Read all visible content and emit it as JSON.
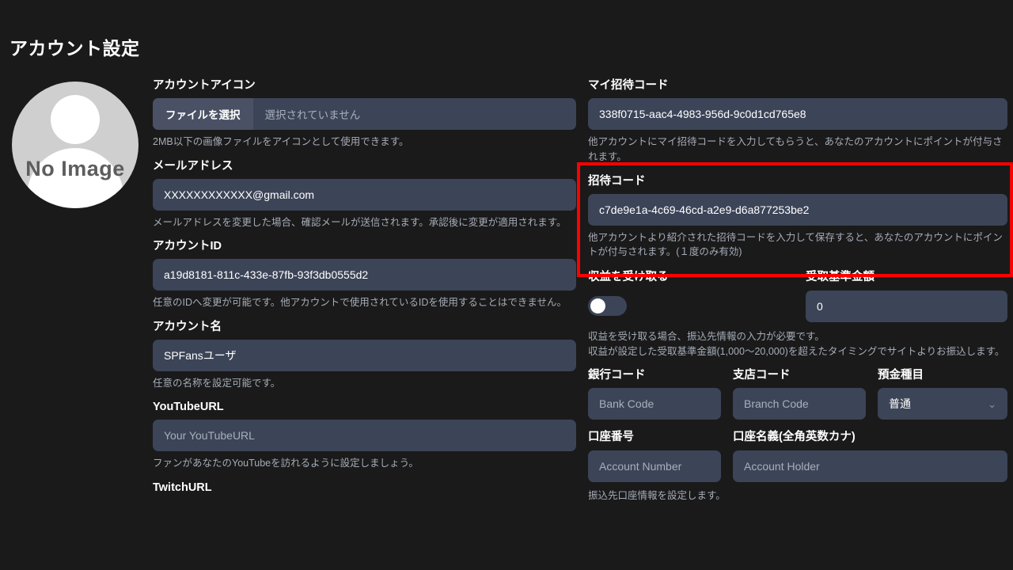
{
  "page": {
    "title": "アカウント設定"
  },
  "avatar": {
    "no_image_text": "No Image"
  },
  "left_column": {
    "account_icon": {
      "label": "アカウントアイコン",
      "button_label": "ファイルを選択",
      "file_status": "選択されていません",
      "hint": "2MB以下の画像ファイルをアイコンとして使用できます。"
    },
    "email": {
      "label": "メールアドレス",
      "value": "XXXXXXXXXXXX@gmail.com",
      "hint": "メールアドレスを変更した場合、確認メールが送信されます。承認後に変更が適用されます。"
    },
    "account_id": {
      "label": "アカウントID",
      "value": "a19d8181-811c-433e-87fb-93f3db0555d2",
      "hint": "任意のIDへ変更が可能です。他アカウントで使用されているIDを使用することはできません。"
    },
    "account_name": {
      "label": "アカウント名",
      "value": "SPFansユーザ",
      "hint": "任意の名称を設定可能です。"
    },
    "youtube_url": {
      "label": "YouTubeURL",
      "placeholder": "Your YouTubeURL",
      "hint": "ファンがあなたのYouTubeを訪れるように設定しましょう。"
    },
    "twitch_url": {
      "label": "TwitchURL"
    }
  },
  "right_column": {
    "my_invite_code": {
      "label": "マイ招待コード",
      "value": "338f0715-aac4-4983-956d-9c0d1cd765e8",
      "hint": "他アカウントにマイ招待コードを入力してもらうと、あなたのアカウントにポイントが付与されます。"
    },
    "invite_code": {
      "label": "招待コード",
      "value": "c7de9e1a-4c69-46cd-a2e9-d6a877253be2",
      "hint": "他アカウントより紹介された招待コードを入力して保存すると、あなたのアカウントにポイントが付与されます。(１度のみ有効)"
    },
    "receive_revenue": {
      "label": "収益を受け取る",
      "toggle_state": "off"
    },
    "threshold_amount": {
      "label": "受取基準金額",
      "value": "0"
    },
    "revenue_hint_line1": "収益を受け取る場合、振込先情報の入力が必要です。",
    "revenue_hint_line2": "収益が設定した受取基準金額(1,000〜20,000)を超えたタイミングでサイトよりお振込します。",
    "bank_code": {
      "label": "銀行コード",
      "placeholder": "Bank Code"
    },
    "branch_code": {
      "label": "支店コード",
      "placeholder": "Branch Code"
    },
    "deposit_type": {
      "label": "預金種目",
      "value": "普通",
      "chevron": "⌄"
    },
    "account_number": {
      "label": "口座番号",
      "placeholder": "Account Number"
    },
    "account_holder": {
      "label": "口座名義(全角英数カナ)",
      "placeholder": "Account Holder"
    },
    "bank_hint": "振込先口座情報を設定します。"
  },
  "colors": {
    "background": "#1a1a1a",
    "field_bg": "#3c4457",
    "file_btn_bg": "#4a5164",
    "highlight_border": "#ff0000",
    "hint_text": "#a5acb8"
  }
}
